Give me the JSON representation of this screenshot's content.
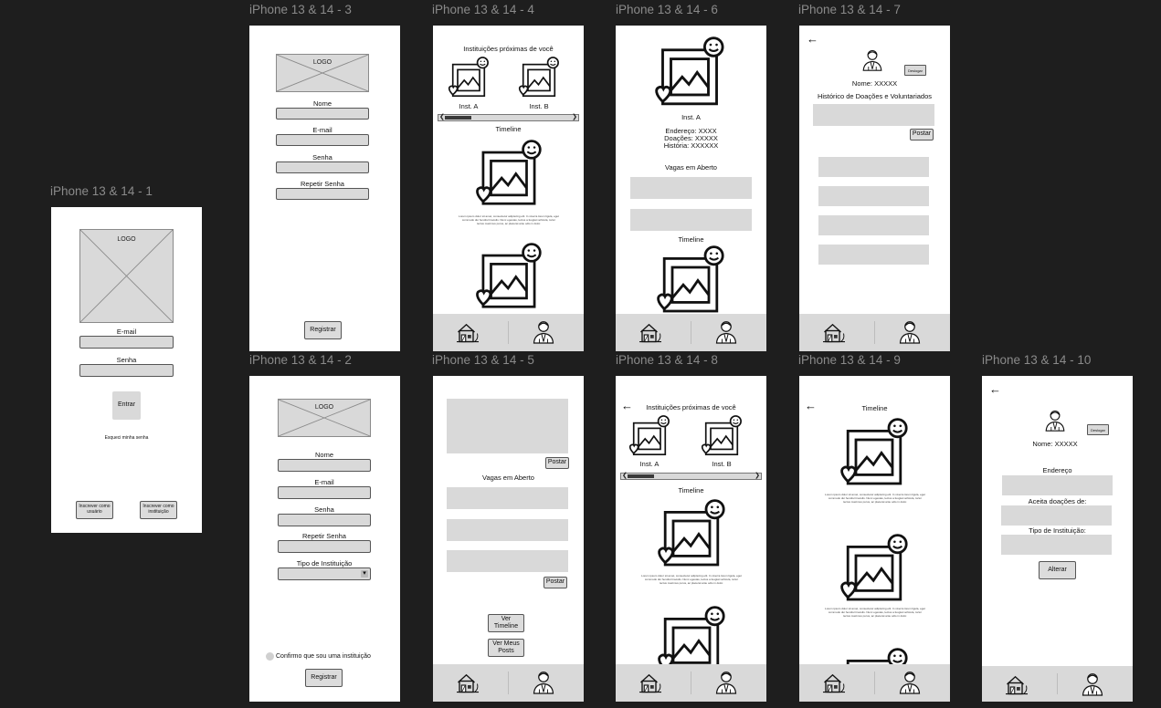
{
  "frames": {
    "f1": {
      "label": "iPhone 13 & 14 - 1",
      "logo": "LOGO",
      "email": "E-mail",
      "senha": "Senha",
      "entrar": "Entrar",
      "esqueci": "Esqueci minha senha",
      "btn_usuario": "Inscrever como usuário",
      "btn_instituicao": "Inscrever como instituição"
    },
    "f3": {
      "label": "iPhone 13 & 14 - 3",
      "logo": "LOGO",
      "nome": "Nome",
      "email": "E-mail",
      "senha": "Senha",
      "repetir": "Repetir Senha",
      "registrar": "Registrar"
    },
    "f2": {
      "label": "iPhone 13 & 14 - 2",
      "logo": "LOGO",
      "nome": "Nome",
      "email": "E-mail",
      "senha": "Senha",
      "repetir": "Repetir Senha",
      "tipo": "Tipo de Instituição",
      "confirmo": "Confirmo que sou uma instituição",
      "registrar": "Registrar"
    },
    "f4": {
      "label": "iPhone 13 & 14 - 4",
      "title": "Instituições próximas de você",
      "inst_a": "Inst. A",
      "inst_b": "Inst. B",
      "timeline": "Timeline",
      "lorem": "Lorem ipsum dolor sit amet, consectetur adipiscing elit. In viverra lorem ligula, eget commodo dui hendrerit iaculis. Nunc egestas, lectus a feugiat vehicula, tortor lectus maximus purus, ac placerat ante odio in dolor."
    },
    "f5": {
      "label": "iPhone 13 & 14 - 5",
      "postar1": "Postar",
      "vagas": "Vagas em Aberto",
      "postar2": "Postar",
      "ver_timeline": "Ver Timeline",
      "ver_posts": "Ver Meus Posts"
    },
    "f6": {
      "label": "iPhone 13 & 14 - 6",
      "inst_a": "Inst. A",
      "endereco": "Endereço: XXXX",
      "doacoes": "Doações: XXXXX",
      "historia": "História: XXXXXX",
      "vagas": "Vagas em Aberto",
      "timeline": "Timeline"
    },
    "f8": {
      "label": "iPhone 13 & 14 - 8",
      "title": "Instituições próximas de você",
      "inst_a": "Inst. A",
      "inst_b": "Inst. B",
      "timeline": "Timeline",
      "lorem": "Lorem ipsum dolor sit amet, consectetur adipiscing elit. In viverra lorem ligula, eget commodo dui hendrerit iaculis. Nunc egestas, lectus a feugiat vehicula, tortor lectus maximus purus, ac placerat ante odio in dolor."
    },
    "f7": {
      "label": "iPhone 13 & 14 - 7",
      "back": "←",
      "deslogar": "Deslogar",
      "nome": "Nome: XXXXX",
      "historico": "Histórico de Doações e Voluntariados",
      "postar": "Postar"
    },
    "f9": {
      "label": "iPhone 13 & 14 - 9",
      "back": "←",
      "timeline": "Timeline",
      "lorem": "Lorem ipsum dolor sit amet, consectetur adipiscing elit. In viverra lorem ligula, eget commodo dui hendrerit iaculis. Nunc egestas, lectus a feugiat vehicula, tortor lectus maximus purus, ac placerat ante odio in dolor."
    },
    "f10": {
      "label": "iPhone 13 & 14 - 10",
      "back": "←",
      "deslogar": "Deslogar",
      "nome": "Nome: XXXXX",
      "endereco": "Endereço",
      "aceita": "Aceita doações de:",
      "tipo": "Tipo de Instituição:",
      "alterar": "Alterar"
    }
  },
  "icons": {
    "home": "home-icon",
    "profile": "profile-icon",
    "image": "image-placeholder-icon",
    "smiley": "smiley-icon",
    "heart": "heart-icon"
  },
  "colors": {
    "canvas": "#1e1e1e",
    "frame": "#ffffff",
    "placeholder": "#d9d9d9",
    "label": "#8a8a8a"
  }
}
